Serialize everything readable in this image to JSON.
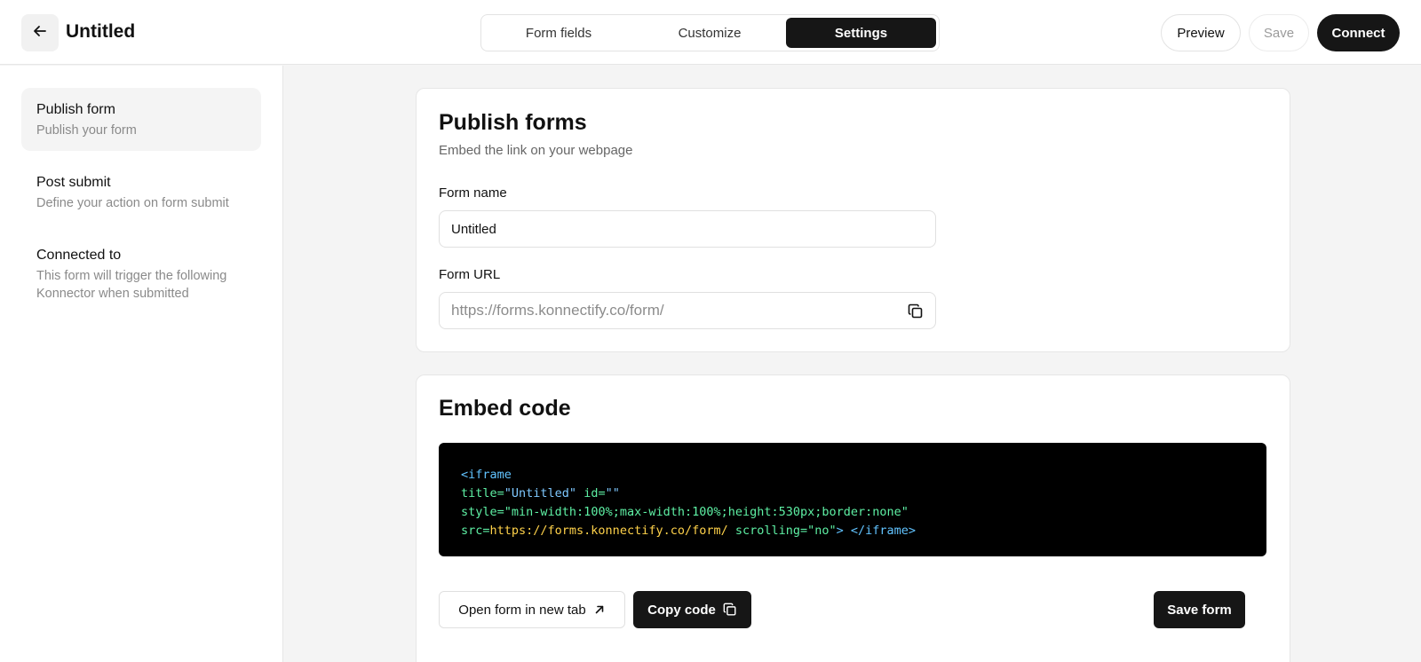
{
  "header": {
    "title": "Untitled",
    "tabs": [
      {
        "label": "Form fields"
      },
      {
        "label": "Customize"
      },
      {
        "label": "Settings"
      }
    ],
    "active_tab": "Settings",
    "preview_label": "Preview",
    "save_label": "Save",
    "connect_label": "Connect"
  },
  "sidebar": {
    "items": [
      {
        "title": "Publish form",
        "subtitle": "Publish your form",
        "active": true
      },
      {
        "title": "Post submit",
        "subtitle": "Define your action on form submit"
      },
      {
        "title": "Connected to",
        "subtitle": "This form will trigger the following Konnector when submitted"
      }
    ]
  },
  "publish": {
    "title": "Publish forms",
    "subtitle": "Embed the link on your webpage",
    "form_name_label": "Form name",
    "form_name_value": "Untitled",
    "form_url_label": "Form URL",
    "form_url_placeholder": "https://forms.konnectify.co/form/"
  },
  "embed": {
    "title": "Embed code",
    "code": {
      "tag_open": "<iframe",
      "title_attr": "title=",
      "title_val": "\"Untitled\"",
      "id_attr": " id=",
      "id_val": "\"\"",
      "style_attr": "style=",
      "style_val": "\"min-width:100%;max-width:100%;height:530px;border:none\"",
      "src_attr": "src=",
      "src_val": "https://forms.konnectify.co/form/",
      "scrolling_attr": " scrolling=",
      "scrolling_val": "\"no\"",
      "tag_close": "> </iframe>"
    },
    "open_label": "Open form in new tab",
    "copy_label": "Copy code",
    "save_form_label": "Save form"
  },
  "icons": {
    "back": "arrow-left-icon",
    "copy": "copy-icon",
    "external": "arrow-up-right-icon"
  },
  "colors": {
    "primary": "#161616",
    "code_bg": "#000000",
    "code_tag": "#61c3ff",
    "code_attr": "#5ef0a4",
    "code_src": "#ffd24a"
  }
}
